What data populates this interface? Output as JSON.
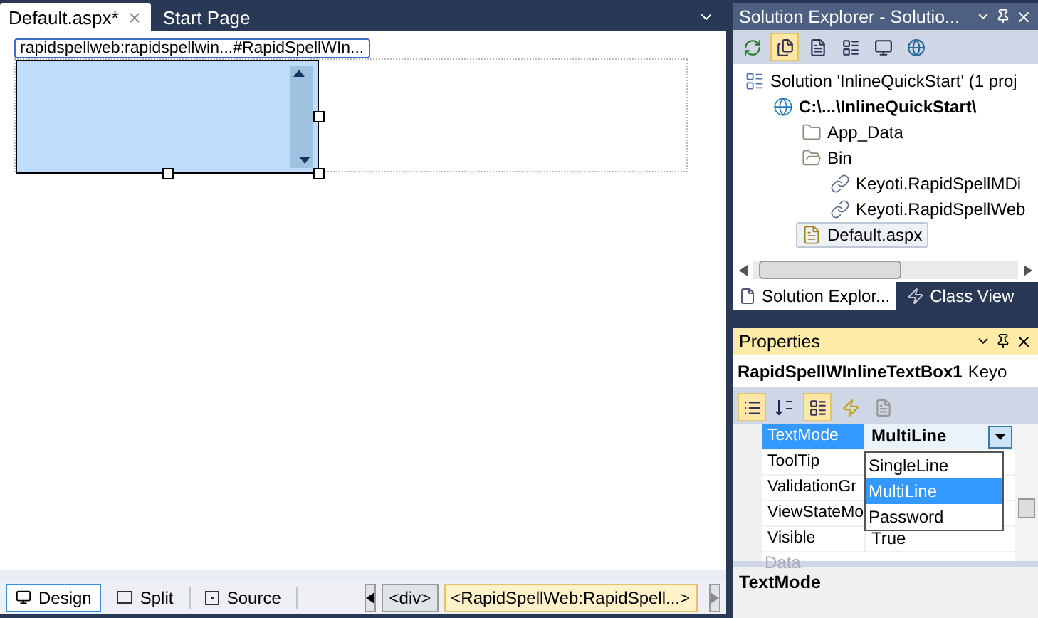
{
  "document_tabs": [
    {
      "label": "Default.aspx*",
      "selected": true
    },
    {
      "label": "Start Page",
      "selected": false
    }
  ],
  "design_surface": {
    "smart_tag": "rapidspellweb:rapidspellwin...#RapidSpellWIn..."
  },
  "view_tabs": [
    {
      "label": "Design",
      "kind": "design",
      "selected": true
    },
    {
      "label": "Split",
      "kind": "split",
      "selected": false
    },
    {
      "label": "Source",
      "kind": "source",
      "selected": false
    }
  ],
  "tag_path": [
    {
      "label": "<div>",
      "selected": false
    },
    {
      "label": "<RapidSpellWeb:RapidSpell...>",
      "selected": true
    }
  ],
  "solution_explorer": {
    "title": "Solution Explorer - Solutio...",
    "active": false,
    "tree": [
      {
        "label": "Solution 'InlineQuickStart' (1 proj",
        "kind": "solution",
        "selected": false,
        "children": [
          {
            "label": "C:\\...\\InlineQuickStart\\",
            "kind": "project",
            "selected": false,
            "children": [
              {
                "label": "App_Data",
                "kind": "folder",
                "selected": false
              },
              {
                "label": "Bin",
                "kind": "folder-open",
                "selected": false,
                "children": [
                  {
                    "label": "Keyoti.RapidSpellMDi",
                    "kind": "reference",
                    "selected": false
                  },
                  {
                    "label": "Keyoti.RapidSpellWeb",
                    "kind": "reference",
                    "selected": false
                  }
                ]
              },
              {
                "label": "Default.aspx",
                "kind": "page",
                "selected": true
              }
            ]
          }
        ]
      }
    ],
    "tabs": [
      {
        "label": "Solution Explor...",
        "selected": true
      },
      {
        "label": "Class View",
        "selected": false
      }
    ]
  },
  "properties": {
    "title": "Properties",
    "active": true,
    "object_name": "RapidSpellWInlineTextBox1",
    "object_type": "Keyo",
    "rows": [
      {
        "kind": "property",
        "name": "TextMode",
        "value": "MultiLine",
        "selected": true
      },
      {
        "kind": "property",
        "name": "ToolTip",
        "selected": false
      },
      {
        "kind": "property",
        "name": "ValidationGr",
        "selected": false
      },
      {
        "kind": "property",
        "name": "ViewStateMo",
        "selected": false
      },
      {
        "kind": "property",
        "name": "Visible",
        "value": "True",
        "selected": false
      },
      {
        "kind": "category",
        "name": "Data"
      }
    ],
    "dropdown": [
      {
        "label": "SingleLine",
        "selected": false
      },
      {
        "label": "MultiLine",
        "selected": true
      },
      {
        "label": "Password",
        "selected": false
      }
    ],
    "description": "TextMode"
  }
}
